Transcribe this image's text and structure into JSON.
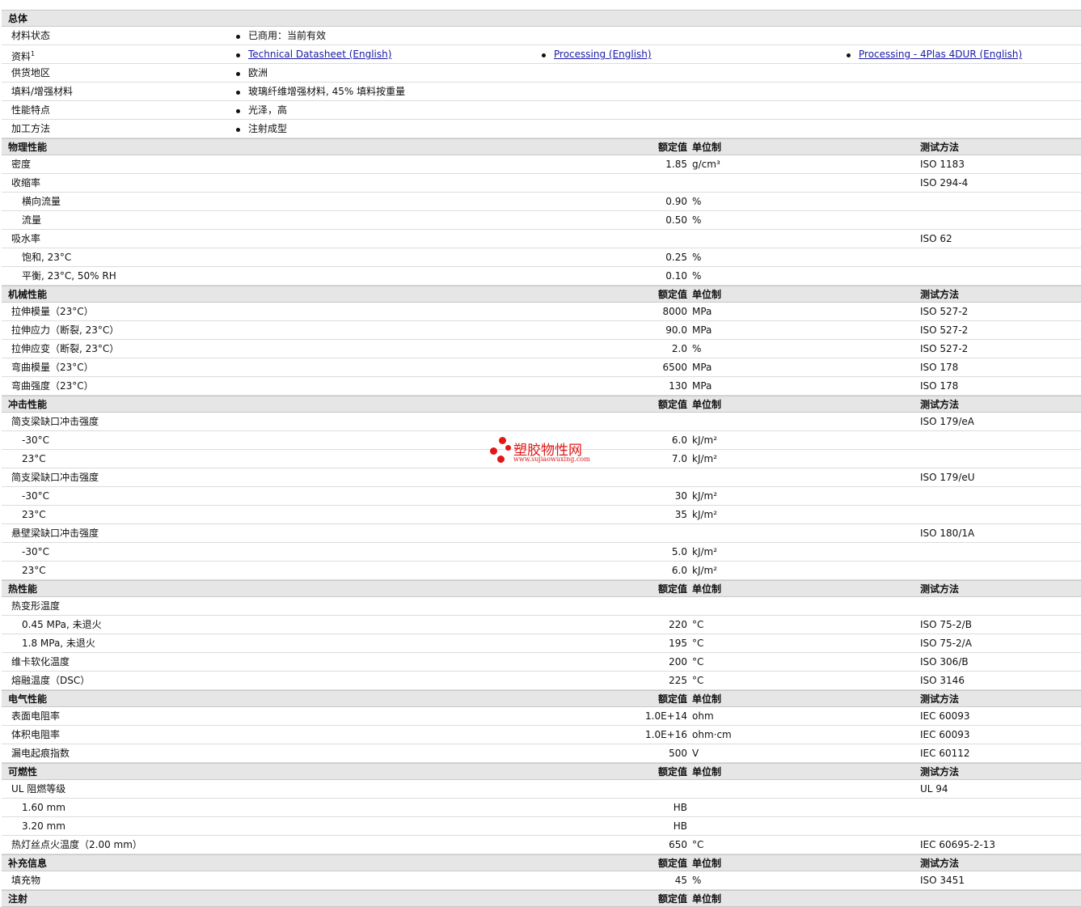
{
  "general": {
    "title": "总体",
    "rows": [
      {
        "label": "材料状态",
        "values": [
          "已商用：当前有效"
        ]
      },
      {
        "label": "资料",
        "sup": "1",
        "links": [
          "Technical Datasheet (English)",
          "Processing (English)",
          "Processing - 4Plas 4DUR (English)"
        ]
      },
      {
        "label": "供货地区",
        "values": [
          "欧洲"
        ]
      },
      {
        "label": "填料/增强材料",
        "values": [
          "玻璃纤维增强材料, 45% 填料按重量"
        ]
      },
      {
        "label": "性能特点",
        "values": [
          "光泽，高"
        ]
      },
      {
        "label": "加工方法",
        "values": [
          "注射成型"
        ]
      }
    ]
  },
  "headers": {
    "value": "额定值",
    "unit": "单位制",
    "test": "测试方法"
  },
  "sections": [
    {
      "title": "物理性能",
      "rows": [
        {
          "label": "密度",
          "value": "1.85",
          "unit": "g/cm³",
          "test": "ISO 1183"
        },
        {
          "label": "收缩率",
          "value": "",
          "unit": "",
          "test": "ISO 294-4"
        },
        {
          "label": "横向流量",
          "sub": true,
          "value": "0.90",
          "unit": "%",
          "test": ""
        },
        {
          "label": "流量",
          "sub": true,
          "value": "0.50",
          "unit": "%",
          "test": ""
        },
        {
          "label": "吸水率",
          "value": "",
          "unit": "",
          "test": "ISO 62"
        },
        {
          "label": "饱和, 23°C",
          "sub": true,
          "value": "0.25",
          "unit": "%",
          "test": ""
        },
        {
          "label": "平衡, 23°C, 50% RH",
          "sub": true,
          "value": "0.10",
          "unit": "%",
          "test": ""
        }
      ]
    },
    {
      "title": "机械性能",
      "rows": [
        {
          "label": "拉伸模量（23°C）",
          "value": "8000",
          "unit": "MPa",
          "test": "ISO 527-2"
        },
        {
          "label": "拉伸应力（断裂, 23°C）",
          "value": "90.0",
          "unit": "MPa",
          "test": "ISO 527-2"
        },
        {
          "label": "拉伸应变（断裂, 23°C）",
          "value": "2.0",
          "unit": "%",
          "test": "ISO 527-2"
        },
        {
          "label": "弯曲模量（23°C）",
          "value": "6500",
          "unit": "MPa",
          "test": "ISO 178"
        },
        {
          "label": "弯曲强度（23°C）",
          "value": "130",
          "unit": "MPa",
          "test": "ISO 178"
        }
      ]
    },
    {
      "title": "冲击性能",
      "rows": [
        {
          "label": "简支梁缺口冲击强度",
          "value": "",
          "unit": "",
          "test": "ISO 179/eA"
        },
        {
          "label": "-30°C",
          "sub": true,
          "value": "6.0",
          "unit": "kJ/m²",
          "test": ""
        },
        {
          "label": "23°C",
          "sub": true,
          "value": "7.0",
          "unit": "kJ/m²",
          "test": ""
        },
        {
          "label": "简支梁缺口冲击强度",
          "value": "",
          "unit": "",
          "test": "ISO 179/eU"
        },
        {
          "label": "-30°C",
          "sub": true,
          "value": "30",
          "unit": "kJ/m²",
          "test": ""
        },
        {
          "label": "23°C",
          "sub": true,
          "value": "35",
          "unit": "kJ/m²",
          "test": ""
        },
        {
          "label": "悬壁梁缺口冲击强度",
          "value": "",
          "unit": "",
          "test": "ISO 180/1A"
        },
        {
          "label": "-30°C",
          "sub": true,
          "value": "5.0",
          "unit": "kJ/m²",
          "test": ""
        },
        {
          "label": "23°C",
          "sub": true,
          "value": "6.0",
          "unit": "kJ/m²",
          "test": ""
        }
      ]
    },
    {
      "title": "热性能",
      "rows": [
        {
          "label": "热变形温度",
          "value": "",
          "unit": "",
          "test": ""
        },
        {
          "label": "0.45 MPa, 未退火",
          "sub": true,
          "value": "220",
          "unit": "°C",
          "test": "ISO 75-2/B"
        },
        {
          "label": "1.8 MPa, 未退火",
          "sub": true,
          "value": "195",
          "unit": "°C",
          "test": "ISO 75-2/A"
        },
        {
          "label": "维卡软化温度",
          "value": "200",
          "unit": "°C",
          "test": "ISO 306/B"
        },
        {
          "label": "熔融温度（DSC）",
          "value": "225",
          "unit": "°C",
          "test": "ISO 3146"
        }
      ]
    },
    {
      "title": "电气性能",
      "rows": [
        {
          "label": "表面电阻率",
          "value": "1.0E+14",
          "unit": "ohm",
          "test": "IEC 60093"
        },
        {
          "label": "体积电阻率",
          "value": "1.0E+16",
          "unit": "ohm·cm",
          "test": "IEC 60093"
        },
        {
          "label": "漏电起痕指数",
          "value": "500",
          "unit": "V",
          "test": "IEC 60112"
        }
      ]
    },
    {
      "title": "可燃性",
      "rows": [
        {
          "label": "UL 阻燃等级",
          "value": "",
          "unit": "",
          "test": "UL 94"
        },
        {
          "label": "1.60 mm",
          "sub": true,
          "value": "HB",
          "unit": "",
          "test": ""
        },
        {
          "label": "3.20 mm",
          "sub": true,
          "value": "HB",
          "unit": "",
          "test": ""
        },
        {
          "label": "热灯丝点火温度（2.00 mm）",
          "value": "650",
          "unit": "°C",
          "test": "IEC 60695-2-13"
        }
      ]
    },
    {
      "title": "补充信息",
      "rows": [
        {
          "label": "填充物",
          "value": "45",
          "unit": "%",
          "test": "ISO 3451"
        }
      ]
    },
    {
      "title": "注射",
      "noTest": true,
      "rows": []
    }
  ],
  "watermark": {
    "name": "塑胶物性网",
    "url": "www.sujiaowuxing.com",
    "color": "#e01818"
  }
}
